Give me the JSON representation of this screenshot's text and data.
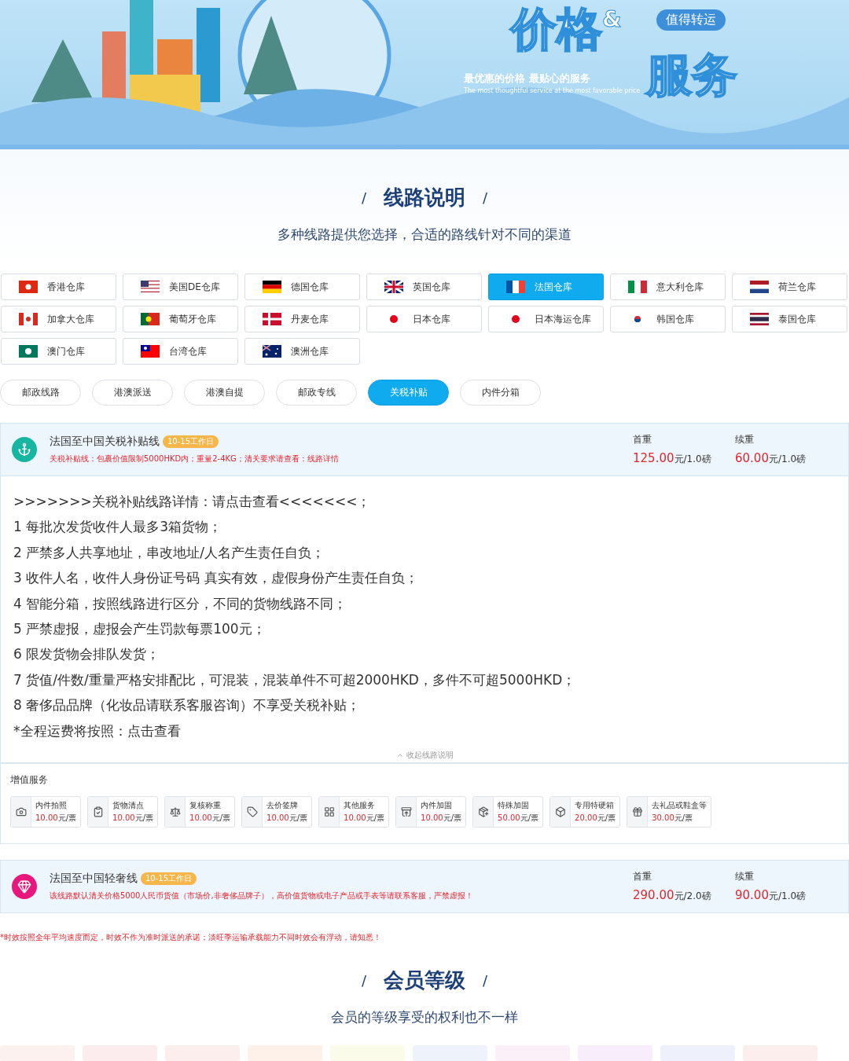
{
  "banner": {
    "title_part_1": "价格",
    "ampersand": "&",
    "title_part_2": "服务",
    "tag": "值得转运",
    "slogan": "最优惠的价格  最贴心的服务",
    "slogan_en": "The most thoughtful service at the most favorable price"
  },
  "route_section": {
    "slash_left": "/",
    "slash_right": "/",
    "title": "线路说明",
    "subtitle": "多种线路提供您选择，合适的路线针对不同的渠道"
  },
  "warehouses": [
    {
      "label": "香港仓库",
      "selected": false
    },
    {
      "label": "美国DE仓库",
      "selected": false
    },
    {
      "label": "德国仓库",
      "selected": false
    },
    {
      "label": "英国仓库",
      "selected": false
    },
    {
      "label": "法国仓库",
      "selected": true
    },
    {
      "label": "意大利仓库",
      "selected": false
    },
    {
      "label": "荷兰仓库",
      "selected": false
    },
    {
      "label": "加拿大仓库",
      "selected": false
    },
    {
      "label": "葡萄牙仓库",
      "selected": false
    },
    {
      "label": "丹麦仓库",
      "selected": false
    },
    {
      "label": "日本仓库",
      "selected": false
    },
    {
      "label": "日本海运仓库",
      "selected": false
    },
    {
      "label": "韩国仓库",
      "selected": false
    },
    {
      "label": "泰国仓库",
      "selected": false
    },
    {
      "label": "澳门仓库",
      "selected": false
    },
    {
      "label": "台湾仓库",
      "selected": false
    },
    {
      "label": "澳洲仓库",
      "selected": false
    }
  ],
  "route_types": [
    {
      "label": "邮政线路",
      "selected": false
    },
    {
      "label": "港澳派送",
      "selected": false
    },
    {
      "label": "港澳自提",
      "selected": false
    },
    {
      "label": "邮政专线",
      "selected": false
    },
    {
      "label": "关税补贴",
      "selected": true
    },
    {
      "label": "内件分箱",
      "selected": false
    }
  ],
  "routes": [
    {
      "kind": "anchor",
      "name": "法国至中国关税补贴线",
      "badge": "10-15工作日",
      "note": "关税补贴线：包裹价值限制5000HKD内；重量2-4KG；清关要求请查看：线路详情",
      "prices": [
        {
          "label": "首重",
          "amount": "125.00",
          "unit": "元/1.0磅"
        },
        {
          "label": "续重",
          "amount": "60.00",
          "unit": "元/1.0磅"
        }
      ],
      "details": [
        ">>>>>>>关税补贴线路详情：请点击查看<<<<<<<；",
        "1 每批次发货收件人最多3箱货物；",
        "2 严禁多人共享地址，串改地址/人名产生责任自负；",
        "3 收件人名，收件人身份证号码 真实有效，虚假身份产生责任自负；",
        "4 智能分箱，按照线路进行区分，不同的货物线路不同；",
        "5 严禁虚报，虚报会产生罚款每票100元；",
        "6 限发货物会排队发货；",
        "7 货值/件数/重量严格安排配比，可混装，混装单件不可超2000HKD，多件不可超5000HKD；",
        "8 奢侈品品牌（化妆品请联系客服咨询）不享受关税补贴；",
        "*全程运费将按照：点击查看"
      ],
      "collapse": "收起线路说明",
      "services_title": "增值服务",
      "services": [
        {
          "name": "内件拍照",
          "price": "10.00",
          "unit": "元/票"
        },
        {
          "name": "货物清点",
          "price": "10.00",
          "unit": "元/票"
        },
        {
          "name": "复核称重",
          "price": "10.00",
          "unit": "元/票"
        },
        {
          "name": "去价签牌",
          "price": "10.00",
          "unit": "元/票"
        },
        {
          "name": "其他服务",
          "price": "10.00",
          "unit": "元/票"
        },
        {
          "name": "内件加固",
          "price": "10.00",
          "unit": "元/票"
        },
        {
          "name": "特殊加固",
          "price": "50.00",
          "unit": "元/票"
        },
        {
          "name": "专用特硬箱",
          "price": "20.00",
          "unit": "元/票"
        },
        {
          "name": "去礼品或鞋盒等",
          "price": "30.00",
          "unit": "元/票"
        }
      ]
    },
    {
      "kind": "diamond",
      "name": "法国至中国轻奢线",
      "badge": "10-15工作日",
      "note": "该线路默认清关价格5000人民币货值（市场价,非奢侈品牌子），高价值货物或电子产品或手表等请联系客服，严禁虚报！",
      "prices": [
        {
          "label": "首重",
          "amount": "290.00",
          "unit": "元/2.0磅"
        },
        {
          "label": "续重",
          "amount": "90.00",
          "unit": "元/1.0磅"
        }
      ]
    }
  ],
  "notice": "*时效按照全年平均速度而定，时效不作为准时派送的承诺；淡旺季运输承载能力不同时效会有浮动，请知悉！",
  "member_section": {
    "slash_left": "/",
    "slash_right": "/",
    "title": "会员等级",
    "subtitle": "会员的等级享受的权利也不一样"
  }
}
